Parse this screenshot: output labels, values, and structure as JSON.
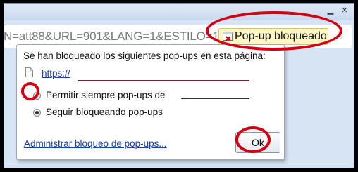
{
  "omnibox": {
    "url_fragment": "N=att88&URL=901&LANG=1&ESTILO=1",
    "blocked_indicator_label": "Pop-up bloqueado"
  },
  "popup": {
    "title": "Se han bloqueado los siguientes pop-ups en esta página:",
    "blocked_link": "https://",
    "option_always_allow": "Permitir siempre pop-ups de",
    "option_keep_blocking": "Seguir bloqueando pop-ups",
    "selected_option": "Seguir bloqueando pop-ups",
    "manage_link": "Administrar bloqueo de pop-ups...",
    "ok_label": "Ok"
  },
  "colors": {
    "highlight_ring": "#d30012",
    "link": "#1a40a8",
    "indicator_background": "#fdf6c3"
  }
}
